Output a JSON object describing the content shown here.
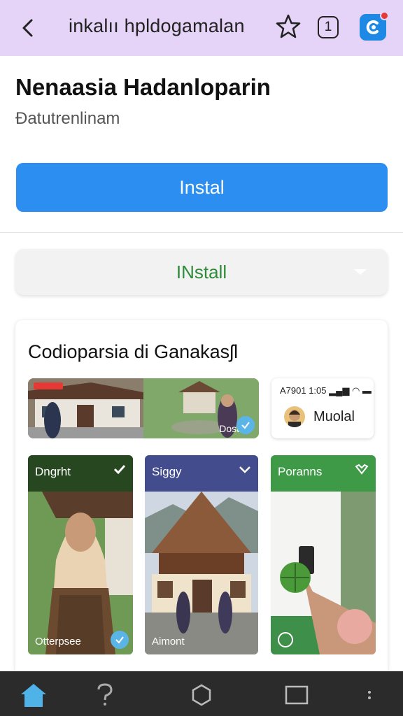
{
  "topbar": {
    "title": "inkalıı hpldogamalan",
    "badge_count": "1",
    "icons": [
      "back-arrow-icon",
      "star-icon",
      "counter-icon",
      "app-logo-icon"
    ]
  },
  "app": {
    "name": "Nenaasia Hadanloparin",
    "subtitle": "Ðatutrenlinam"
  },
  "buttons": {
    "install_primary": "Instal",
    "install_secondary": "INstall"
  },
  "card": {
    "title": "Codioparsia di Ganakasʃl",
    "banner_label": "Dostall",
    "mini_card": {
      "status": "A7901 1:05",
      "name": "Muolal"
    },
    "tiles": [
      {
        "header": "Dngrht",
        "footer": "Otterpsee",
        "color": "#26471f"
      },
      {
        "header": "Siggy",
        "footer": "Aimont",
        "color": "#434c8c"
      },
      {
        "header": "Poranns",
        "footer": "",
        "color": "#3f9a48"
      }
    ]
  },
  "colors": {
    "topbar": "#e5d4f7",
    "primary": "#2b8ef0",
    "secondary_text": "#2e8b3a",
    "bottombar": "#2b2b2b"
  },
  "bottom_nav": [
    "home-icon",
    "help-icon",
    "hexagon-icon",
    "square-icon",
    "more-icon"
  ]
}
